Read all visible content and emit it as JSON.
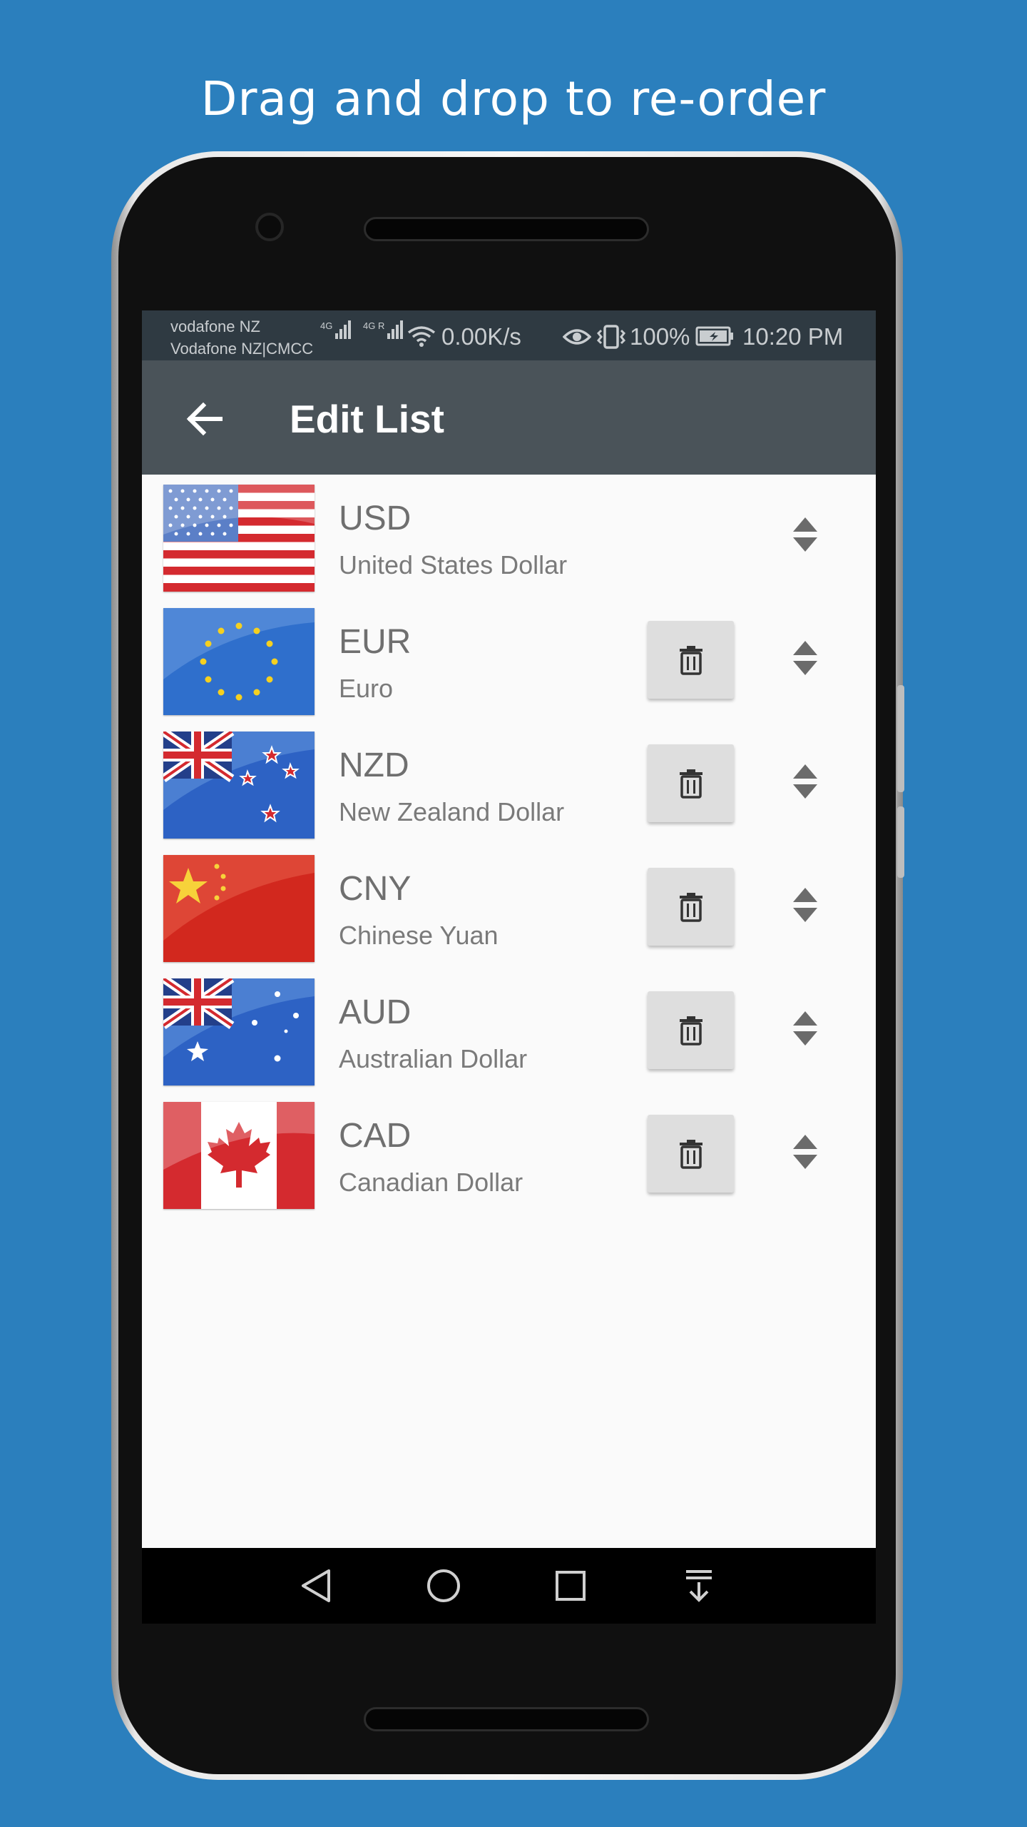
{
  "headline": "Drag and drop to re-order",
  "statusbar": {
    "carrier_1": "vodafone NZ",
    "carrier_2": "Vodafone NZ|CMCC",
    "signal_1_tag": "4G",
    "signal_2_tag": "4G R",
    "net_speed": "0.00K/s",
    "battery": "100%",
    "time": "10:20 PM"
  },
  "appbar": {
    "back_icon": "arrow-left-icon",
    "title": "Edit List"
  },
  "currencies": [
    {
      "code": "USD",
      "name": "United States Dollar",
      "flag": "us-flag",
      "deletable": false
    },
    {
      "code": "EUR",
      "name": "Euro",
      "flag": "eu-flag",
      "deletable": true
    },
    {
      "code": "NZD",
      "name": "New Zealand Dollar",
      "flag": "nz-flag",
      "deletable": true
    },
    {
      "code": "CNY",
      "name": "Chinese Yuan",
      "flag": "cn-flag",
      "deletable": true
    },
    {
      "code": "AUD",
      "name": "Australian Dollar",
      "flag": "au-flag",
      "deletable": true
    },
    {
      "code": "CAD",
      "name": "Canadian Dollar",
      "flag": "ca-flag",
      "deletable": true
    }
  ],
  "icons": {
    "delete": "trash-icon",
    "reorder": "drag-handle-icon",
    "nav_back": "nav-back-icon",
    "nav_home": "nav-home-icon",
    "nav_recents": "nav-recents-icon",
    "nav_notifications": "nav-pull-down-icon"
  },
  "colors": {
    "page_background": "#2b7fbd",
    "status_bar": "#2f3a42",
    "app_bar": "#4a5359",
    "list_background": "#fafafa",
    "delete_button": "#dedede"
  }
}
